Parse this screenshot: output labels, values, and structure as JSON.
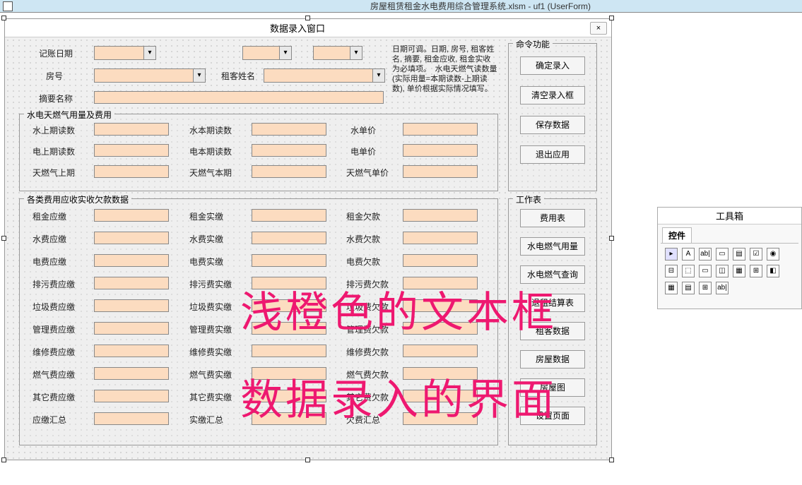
{
  "window": {
    "title": "房屋租赁租金水电费用综合管理系统.xlsm - uf1 (UserForm)",
    "form_title": "数据录入窗口",
    "close_x": "×"
  },
  "top_row": {
    "label_date": "记账日期",
    "label_room": "房号",
    "label_tenant": "租客姓名",
    "label_summary": "摘要名称"
  },
  "help_text": "日期可调。日期, 房号, 租客姓名, 摘要, 租金应收, 租金实收为必填项。　水电天燃气读数量 (实际用量=本期读数-上期读数), 单价根据实际情况填写。",
  "frame_utility": {
    "title": "水电天燃气用量及费用",
    "r1c1": "水上期读数",
    "r1c2": "水本期读数",
    "r1c3": "水单价",
    "r2c1": "电上期读数",
    "r2c2": "电本期读数",
    "r2c3": "电单价",
    "r3c1": "天燃气上期",
    "r3c2": "天燃气本期",
    "r3c3": "天燃气单价"
  },
  "frame_fees": {
    "title": "各类费用应收实收欠款数据",
    "rows": [
      {
        "c1": "租金应缴",
        "c2": "租金实缴",
        "c3": "租金欠款"
      },
      {
        "c1": "水费应缴",
        "c2": "水费实缴",
        "c3": "水费欠款"
      },
      {
        "c1": "电费应缴",
        "c2": "电费实缴",
        "c3": "电费欠款"
      },
      {
        "c1": "排污费应缴",
        "c2": "排污费实缴",
        "c3": "排污费欠款"
      },
      {
        "c1": "垃圾费应缴",
        "c2": "垃圾费实缴",
        "c3": "垃圾费欠款"
      },
      {
        "c1": "管理费应缴",
        "c2": "管理费实缴",
        "c3": "管理费欠款"
      },
      {
        "c1": "维修费应缴",
        "c2": "维修费实缴",
        "c3": "维修费欠款"
      },
      {
        "c1": "燃气费应缴",
        "c2": "燃气费实缴",
        "c3": "燃气费欠款"
      },
      {
        "c1": "其它费应缴",
        "c2": "其它费实缴",
        "c3": "其它费欠款"
      },
      {
        "c1": "应缴汇总",
        "c2": "实缴汇总",
        "c3": "欠费汇总"
      }
    ]
  },
  "frame_cmd": {
    "title": "命令功能",
    "btns": [
      "确定录入",
      "清空录入框",
      "保存数据",
      "退出应用"
    ]
  },
  "frame_sheets": {
    "title": "工作表",
    "btns": [
      "费用表",
      "水电燃气用量",
      "水电燃气查询",
      "退租结算表",
      "租客数据",
      "房屋数据",
      "房屋图",
      "设置页面"
    ]
  },
  "toolbox": {
    "title": "工具箱",
    "tab": "控件",
    "icons": [
      "▸",
      "A",
      "ab|",
      "▭",
      "▤",
      "☑",
      "◉",
      "⊟",
      "⬚",
      "▭",
      "◫",
      "▦",
      "⊞",
      "◧",
      "▦",
      "▤",
      "⊞",
      "ab|"
    ]
  },
  "overlay": {
    "line1": "浅橙色的文本框",
    "line2": "数据录入的界面"
  }
}
